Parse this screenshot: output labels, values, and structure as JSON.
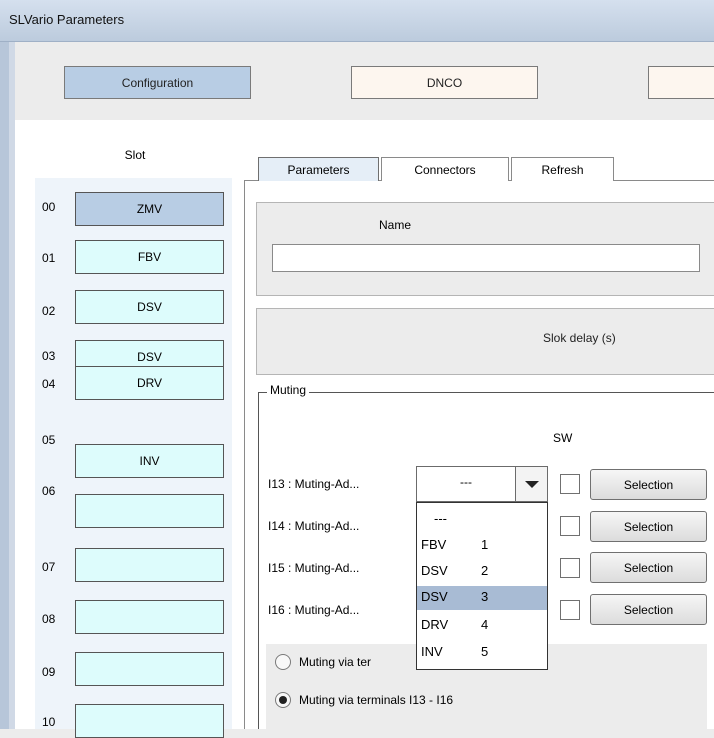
{
  "window": {
    "title": "SLVario Parameters"
  },
  "nav": {
    "configuration": "Configuration",
    "dnco": "DNCO",
    "third": ""
  },
  "slots": {
    "header": "Slot",
    "items": [
      {
        "num": "00",
        "label": "ZMV"
      },
      {
        "num": "01",
        "label": "FBV"
      },
      {
        "num": "02",
        "label": "DSV"
      },
      {
        "num": "03",
        "label": "DSV"
      },
      {
        "num": "04",
        "label": "DRV"
      },
      {
        "num": "05",
        "label": "INV"
      },
      {
        "num": "06",
        "label": ""
      },
      {
        "num": "07",
        "label": ""
      },
      {
        "num": "08",
        "label": ""
      },
      {
        "num": "09",
        "label": ""
      },
      {
        "num": "10",
        "label": ""
      }
    ],
    "selected": "00"
  },
  "tabs": {
    "parameters": "Parameters",
    "connectors": "Connectors",
    "refresh": "Refresh",
    "active": "Parameters"
  },
  "name_section": {
    "label": "Name",
    "value": ""
  },
  "slok": {
    "label": "Slok delay (s)"
  },
  "muting": {
    "legend": "Muting",
    "sw_label": "SW",
    "rows": [
      {
        "label": "I13 : Muting-Ad...",
        "button": "Selection"
      },
      {
        "label": "I14 : Muting-Ad...",
        "button": "Selection"
      },
      {
        "label": "I15 : Muting-Ad...",
        "button": "Selection"
      },
      {
        "label": "I16 : Muting-Ad...",
        "button": "Selection"
      }
    ],
    "combo_value": "---",
    "dropdown": {
      "options": [
        {
          "name": "---",
          "index": ""
        },
        {
          "name": "FBV",
          "index": "1"
        },
        {
          "name": "DSV",
          "index": "2"
        },
        {
          "name": "DSV",
          "index": "3"
        },
        {
          "name": "DRV",
          "index": "4"
        },
        {
          "name": "INV",
          "index": "5"
        }
      ],
      "highlighted": 3
    },
    "radios": [
      {
        "label": "Muting via ter",
        "checked": false
      },
      {
        "label": "Muting via terminals I13 - I16",
        "checked": true
      }
    ]
  },
  "colors": {
    "selected": "#b8cde4",
    "slot_bg": "#ddfcfc",
    "highlight": "#a8bbd4"
  }
}
